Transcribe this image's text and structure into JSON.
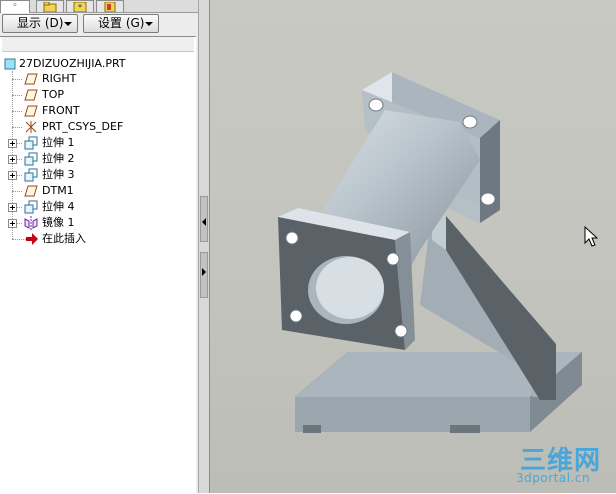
{
  "menu": {
    "display_label": "显示 (D)",
    "settings_label": "设置 (G)"
  },
  "tree": {
    "root": "27DIZUOZHIJIA.PRT",
    "items": [
      {
        "label": "RIGHT",
        "icon": "datum-plane-icon",
        "expandable": false
      },
      {
        "label": "TOP",
        "icon": "datum-plane-icon",
        "expandable": false
      },
      {
        "label": "FRONT",
        "icon": "datum-plane-icon",
        "expandable": false
      },
      {
        "label": "PRT_CSYS_DEF",
        "icon": "coordinate-system-icon",
        "expandable": false
      },
      {
        "label": "拉伸 1",
        "icon": "extrude-icon",
        "expandable": true
      },
      {
        "label": "拉伸 2",
        "icon": "extrude-icon",
        "expandable": true
      },
      {
        "label": "拉伸 3",
        "icon": "extrude-icon",
        "expandable": true
      },
      {
        "label": "DTM1",
        "icon": "datum-plane-icon",
        "expandable": false
      },
      {
        "label": "拉伸 4",
        "icon": "extrude-icon",
        "expandable": true
      },
      {
        "label": "镜像 1",
        "icon": "mirror-icon",
        "expandable": true
      },
      {
        "label": "在此插入",
        "icon": "insert-here-arrow-icon",
        "expandable": false
      }
    ]
  },
  "watermark": {
    "title": "三维网",
    "url": "3dportal.cn"
  },
  "colors": {
    "viewport_bg": "#c6c7c0",
    "part_face_light": "#b9c4cc",
    "part_face_dark": "#5b6268",
    "watermark": "#4aa6d8",
    "insert_arrow": "#c4001a"
  }
}
